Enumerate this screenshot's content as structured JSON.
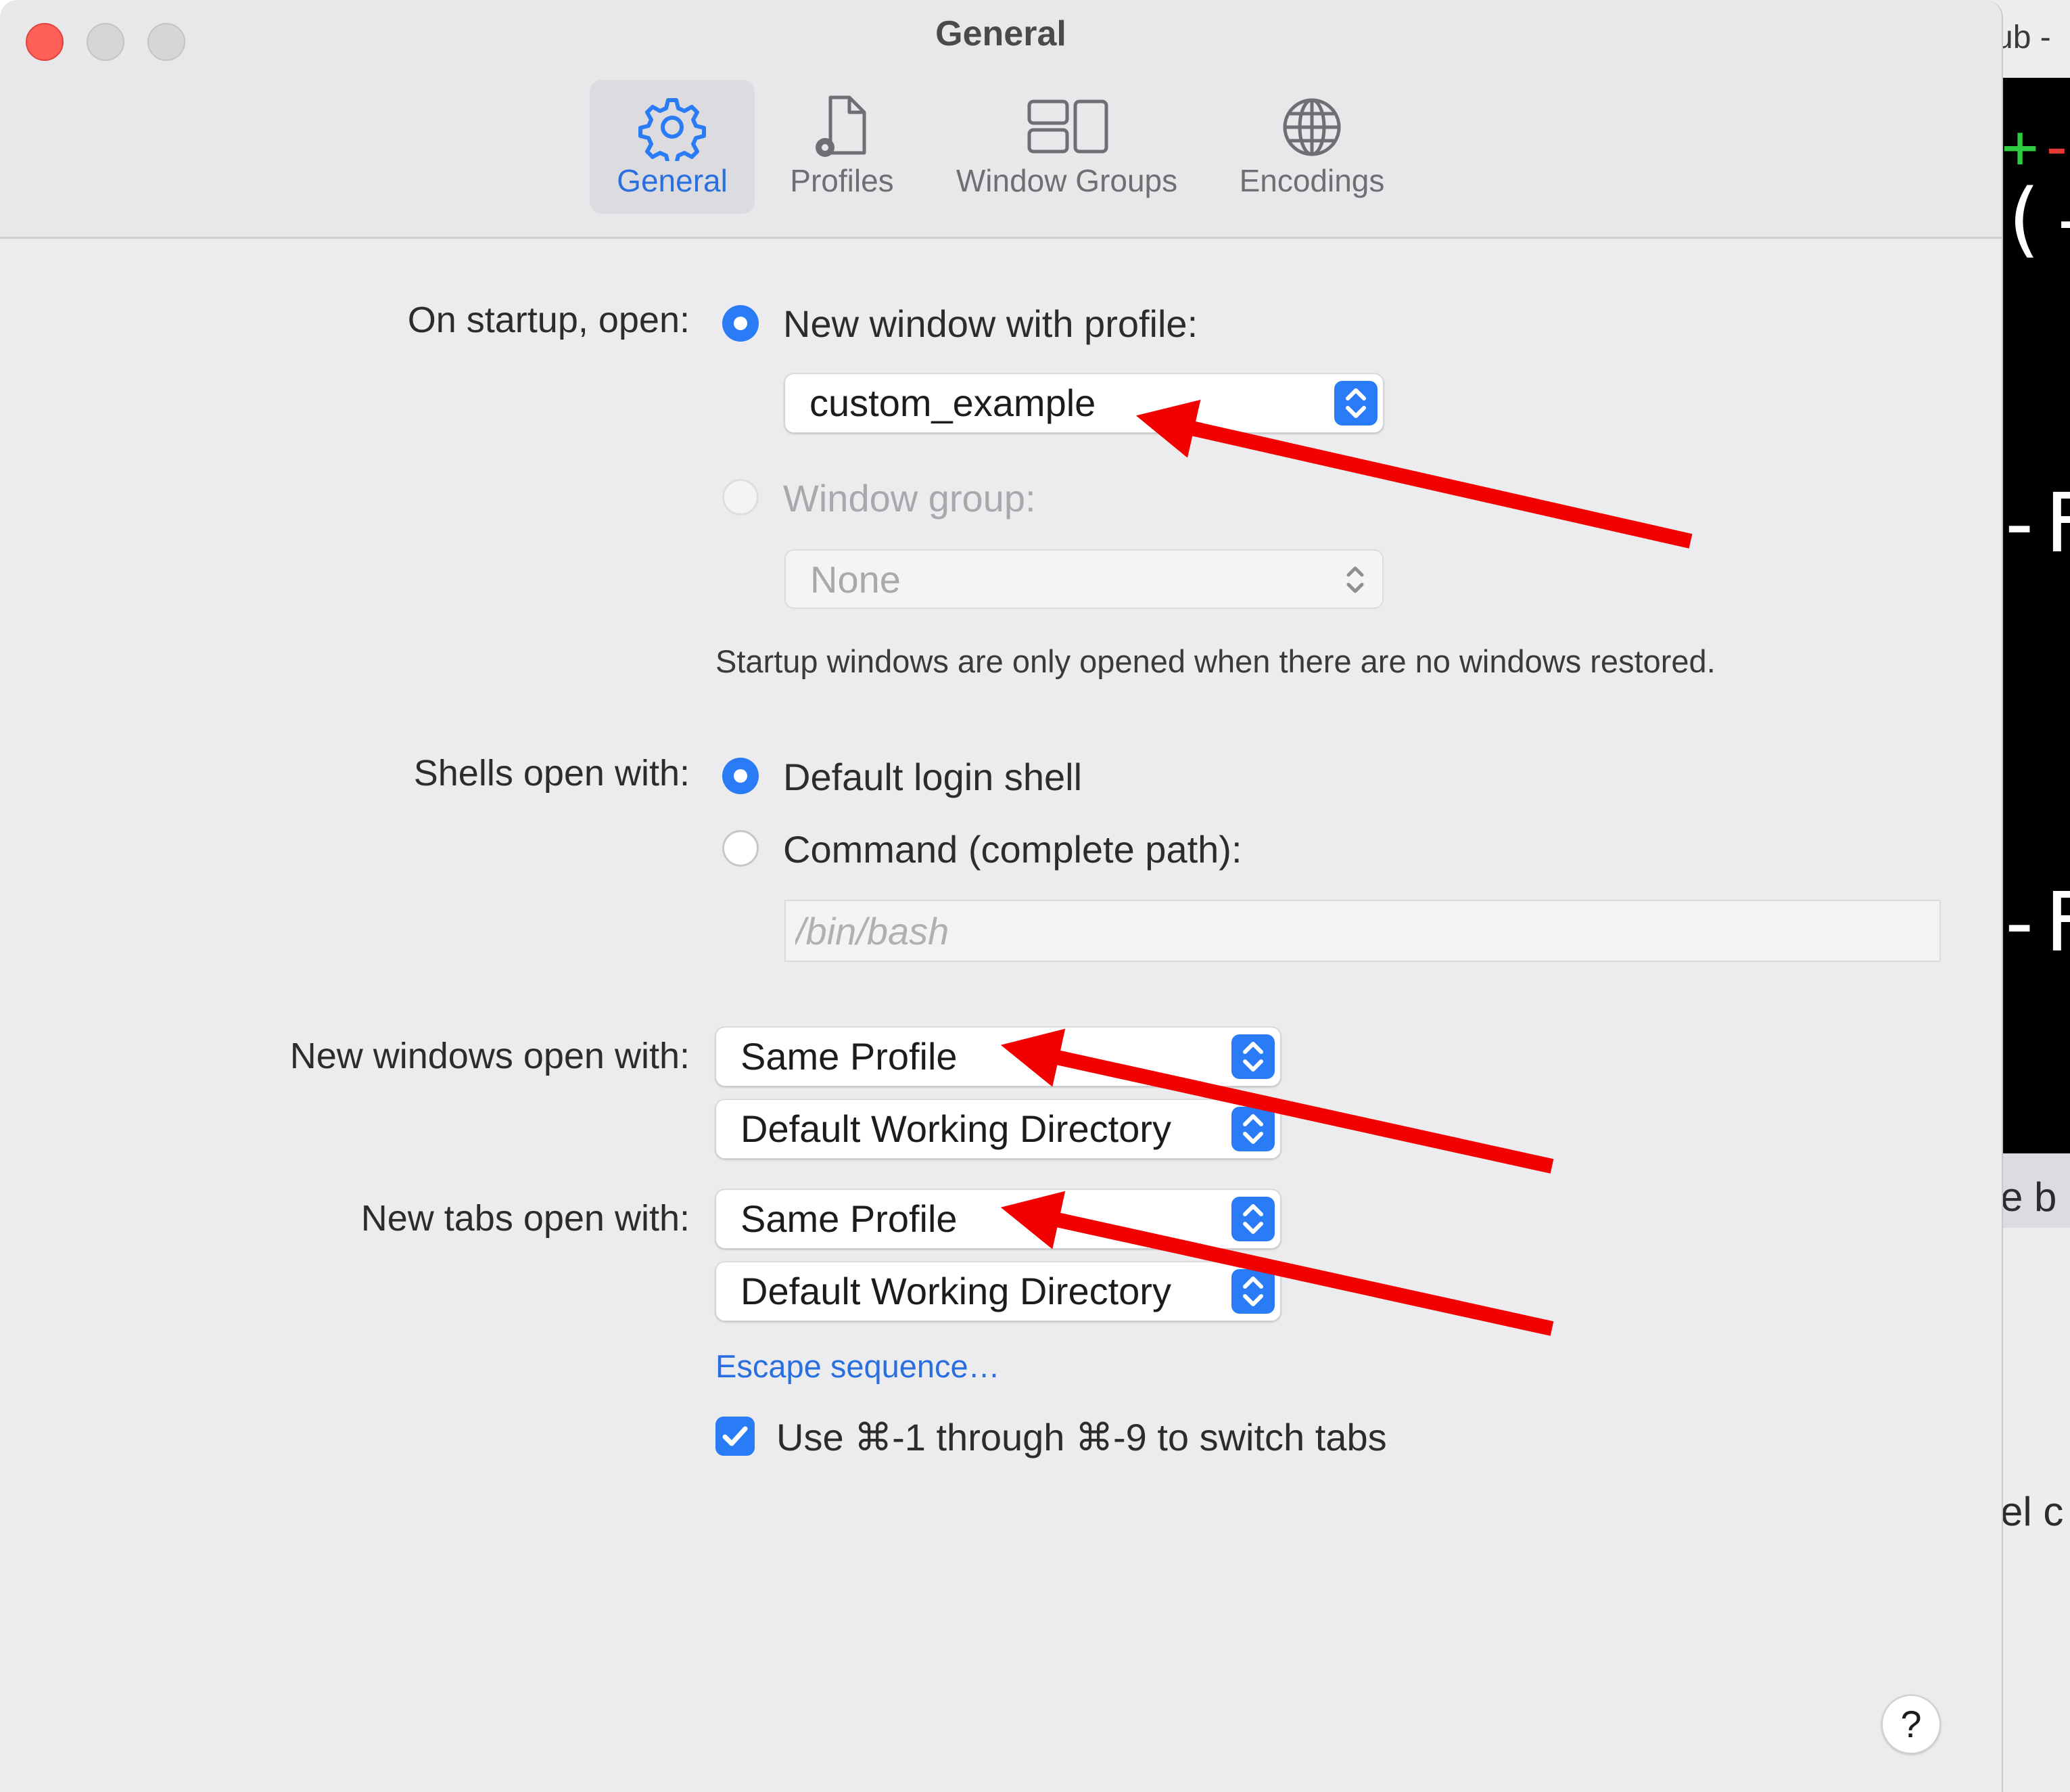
{
  "window": {
    "title": "General"
  },
  "tabs": [
    {
      "label": "General",
      "icon": "gear-icon",
      "selected": true
    },
    {
      "label": "Profiles",
      "icon": "profile-document-icon",
      "selected": false
    },
    {
      "label": "Window Groups",
      "icon": "window-groups-icon",
      "selected": false
    },
    {
      "label": "Encodings",
      "icon": "globe-icon",
      "selected": false
    }
  ],
  "startup": {
    "label": "On startup, open:",
    "option_new_window": "New window with profile:",
    "profile_value": "custom_example",
    "option_window_group": "Window group:",
    "window_group_value": "None",
    "note": "Startup windows are only opened when there are no windows restored."
  },
  "shells": {
    "label": "Shells open with:",
    "option_default": "Default login shell",
    "option_command": "Command (complete path):",
    "command_placeholder": "/bin/bash"
  },
  "new_windows": {
    "label": "New windows open with:",
    "profile_value": "Same Profile",
    "directory_value": "Default Working Directory"
  },
  "new_tabs": {
    "label": "New tabs open with:",
    "profile_value": "Same Profile",
    "directory_value": "Default Working Directory"
  },
  "escape_link": "Escape sequence…",
  "switch_tabs_checkbox": {
    "label": "Use ⌘-1 through ⌘-9 to switch tabs",
    "checked": true
  },
  "help_label": "?",
  "background_window": {
    "title_fragment": "ub -",
    "terminal_fragments": [
      "(-",
      "-F",
      "-F"
    ],
    "text_fragments": [
      "e b",
      "el c"
    ]
  },
  "colors": {
    "accent": "#2a7bf6",
    "annotation_arrow": "#f20000",
    "close_button": "#fe5f57"
  }
}
